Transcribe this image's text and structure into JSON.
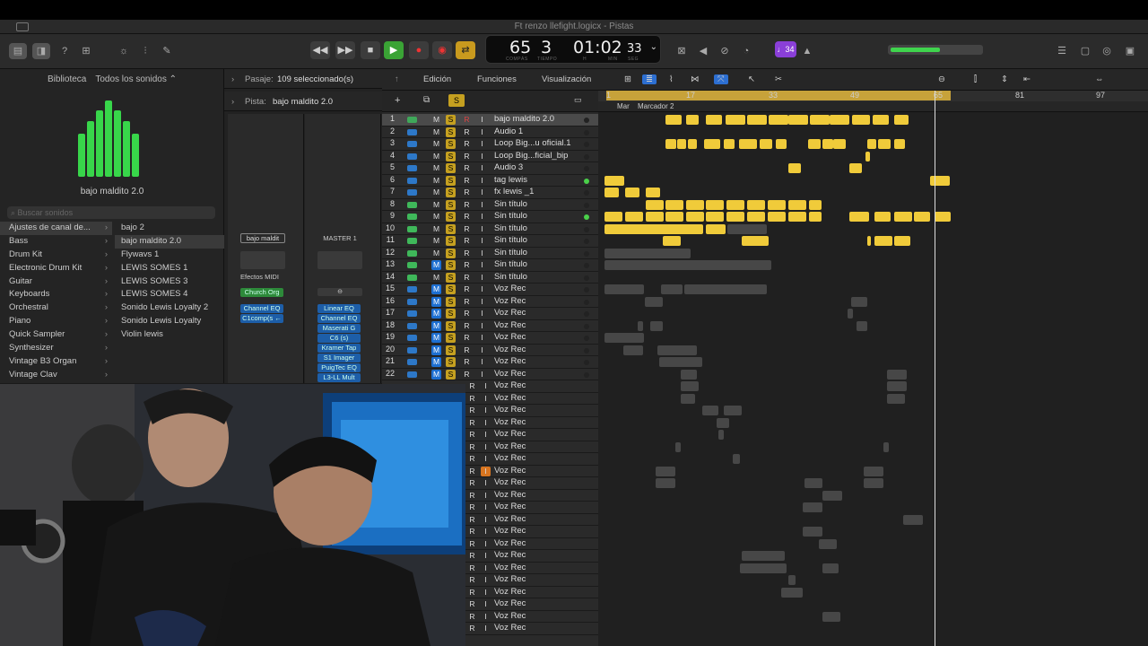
{
  "window": {
    "title": "Ft renzo llefight.logicx - Pistas"
  },
  "toolbar": {
    "badge": "♩34"
  },
  "lcd": {
    "bars": "65",
    "beat": "3",
    "time": "01:02",
    "sub": "33",
    "labels": [
      "COMPÁS",
      "TIEMPO",
      "H",
      "MIN",
      "SEG"
    ]
  },
  "meter": {
    "level": 0.55
  },
  "library": {
    "tabs": [
      "Biblioteca",
      "Todos los sonidos ⌃"
    ],
    "patch_name": "bajo maldito 2.0",
    "search_placeholder": "Buscar sonidos",
    "categories": [
      "Ajustes de canal de...",
      "Bass",
      "Drum Kit",
      "Electronic Drum Kit",
      "Guitar",
      "Keyboards",
      "Orchestral",
      "Piano",
      "Quick Sampler",
      "Synthesizer",
      "Vintage B3 Organ",
      "Vintage Clav"
    ],
    "patches": [
      "bajo 2",
      "bajo maldito 2.0",
      "Flywavs 1",
      "LEWIS SOMES 1",
      "LEWIS SOMES 3",
      "LEWIS SOMES 4",
      "Sonido Lewis Loyalty 2",
      "Sonido Lewis Loyalty",
      "Violin lewis"
    ]
  },
  "inspector": {
    "region_label": "Pasaje:",
    "region_value": "109 seleccionado(s)",
    "track_label": "Pista:",
    "track_value": "bajo maldito 2.0",
    "strip1_name": "bajo maldit",
    "strip2_name": "MASTER 1",
    "midi_fx": "Efectos MIDI",
    "instrument": "Church Org",
    "strip1_plugins": [
      "Channel EQ",
      "C1comp(s ←"
    ],
    "strip2_plugins": [
      "Linear EQ",
      "Channel EQ",
      "Maserati G",
      "C6 (s)",
      "Kramer Tap",
      "S1 Imager",
      "PuigTec EQ",
      "L3-LL Mult"
    ]
  },
  "arrange": {
    "menus": [
      "Edición",
      "Funciones",
      "Visualización"
    ],
    "ruler": [
      "1",
      "17",
      "33",
      "49",
      "65",
      "81",
      "97"
    ],
    "markers": [
      "Mar",
      "Marcador 2"
    ],
    "tracks": [
      {
        "n": "1",
        "name": "bajo maldito 2.0",
        "icon": "#3fa85a"
      },
      {
        "n": "2",
        "name": "Audio 1",
        "icon": "#2d78c8"
      },
      {
        "n": "3",
        "name": "Loop Big...u oficial.1",
        "icon": "#2d78c8"
      },
      {
        "n": "4",
        "name": "Loop Big...ficial_bip",
        "icon": "#2d78c8"
      },
      {
        "n": "5",
        "name": "Audio 3",
        "icon": "#2d78c8"
      },
      {
        "n": "6",
        "name": "tag lewis",
        "icon": "#2d78c8"
      },
      {
        "n": "7",
        "name": "fx lewis _1",
        "icon": "#2d78c8"
      },
      {
        "n": "8",
        "name": "Sin título",
        "icon": "#3fb85a"
      },
      {
        "n": "9",
        "name": "Sin título",
        "icon": "#3fb85a"
      },
      {
        "n": "10",
        "name": "Sin título",
        "icon": "#3fb85a"
      },
      {
        "n": "11",
        "name": "Sin título",
        "icon": "#3fb85a"
      },
      {
        "n": "12",
        "name": "Sin título",
        "icon": "#3fb85a"
      },
      {
        "n": "13",
        "name": "Sin título",
        "icon": "#3fb85a"
      },
      {
        "n": "14",
        "name": "Sin título",
        "icon": "#3fb85a"
      },
      {
        "n": "15",
        "name": "Voz Rec",
        "icon": "#2d78c8"
      },
      {
        "n": "16",
        "name": "Voz Rec",
        "icon": "#2d78c8"
      },
      {
        "n": "17",
        "name": "Voz Rec",
        "icon": "#2d78c8"
      },
      {
        "n": "18",
        "name": "Voz Rec",
        "icon": "#2d78c8"
      },
      {
        "n": "19",
        "name": "Voz Rec",
        "icon": "#2d78c8"
      },
      {
        "n": "20",
        "name": "Voz Rec",
        "icon": "#2d78c8"
      },
      {
        "n": "21",
        "name": "Voz Rec",
        "icon": "#2d78c8"
      },
      {
        "n": "22",
        "name": "Voz Rec",
        "icon": "#2d78c8"
      },
      {
        "n": "",
        "name": "Voz Rec",
        "icon": ""
      },
      {
        "n": "",
        "name": "Voz Rec",
        "icon": ""
      },
      {
        "n": "",
        "name": "Voz Rec",
        "icon": ""
      },
      {
        "n": "",
        "name": "Voz Rec",
        "icon": ""
      },
      {
        "n": "",
        "name": "Voz Rec",
        "icon": ""
      },
      {
        "n": "",
        "name": "Voz Rec",
        "icon": ""
      },
      {
        "n": "",
        "name": "Voz Rec",
        "icon": ""
      },
      {
        "n": "",
        "name": "Voz Rec",
        "icon": ""
      },
      {
        "n": "",
        "name": "Voz Rec",
        "icon": ""
      },
      {
        "n": "",
        "name": "Voz Rec",
        "icon": ""
      },
      {
        "n": "",
        "name": "Voz Rec",
        "icon": ""
      },
      {
        "n": "",
        "name": "Voz Rec",
        "icon": ""
      },
      {
        "n": "",
        "name": "Voz Rec",
        "icon": ""
      },
      {
        "n": "",
        "name": "Voz Rec",
        "icon": ""
      },
      {
        "n": "",
        "name": "Voz Rec",
        "icon": ""
      },
      {
        "n": "",
        "name": "Voz Rec",
        "icon": ""
      },
      {
        "n": "",
        "name": "Voz Rec",
        "icon": ""
      },
      {
        "n": "",
        "name": "Voz Rec",
        "icon": ""
      },
      {
        "n": "",
        "name": "Voz Rec",
        "icon": ""
      },
      {
        "n": "",
        "name": "Voz Rec",
        "icon": ""
      },
      {
        "n": "",
        "name": "Voz Rec",
        "icon": ""
      }
    ]
  }
}
